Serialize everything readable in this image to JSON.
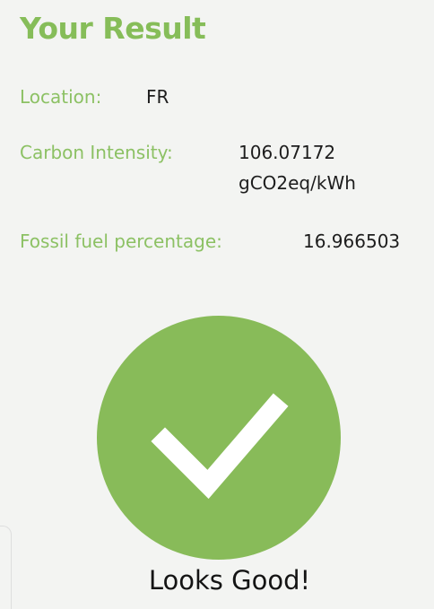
{
  "header": {
    "title": "Your Result"
  },
  "results": {
    "location_label": "Location:",
    "location_value": "FR",
    "carbon_label": "Carbon Intensity:",
    "carbon_value_line1": "106.07172",
    "carbon_value_line2": "gCO2eq/kWh",
    "fossil_label": "Fossil fuel percentage:",
    "fossil_value": "16.966503"
  },
  "status": {
    "icon": "checkmark-icon",
    "message": "Looks Good!",
    "color": "#88bb59"
  },
  "theme": {
    "accent": "#86bd59",
    "background": "#f3f4f2",
    "text": "#1d1d1d"
  }
}
